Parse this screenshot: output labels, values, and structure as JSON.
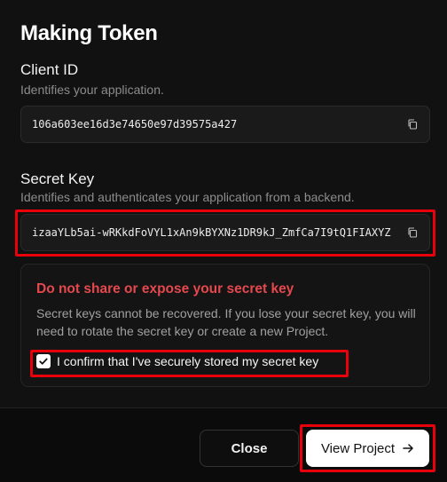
{
  "dialog": {
    "title": "Making Token"
  },
  "client_id": {
    "label": "Client ID",
    "description": "Identifies your application.",
    "value": "106a603ee16d3e74650e97d39575a427",
    "copy_icon": "copy-icon"
  },
  "secret_key": {
    "label": "Secret Key",
    "description": "Identifies and authenticates your application from a backend.",
    "value": "izaaYLb5ai-wRKkdFoVYL1xAn9kBYXNz1DR9kJ_ZmfCa7I9tQ1FIAXYZ",
    "copy_icon": "copy-icon"
  },
  "warning": {
    "title": "Do not share or expose your secret key",
    "body": "Secret keys cannot be recovered. If you lose your secret key, you will need to rotate the secret key or create a new Project.",
    "confirm_label": "I confirm that I've securely stored my secret key",
    "confirm_checked": true
  },
  "footer": {
    "close_label": "Close",
    "view_project_label": "View Project",
    "arrow_icon": "arrow-right-icon"
  },
  "colors": {
    "background": "#111111",
    "warning_title": "#e5484d",
    "highlight": "#e8000b",
    "primary_button": "#ffffff"
  }
}
